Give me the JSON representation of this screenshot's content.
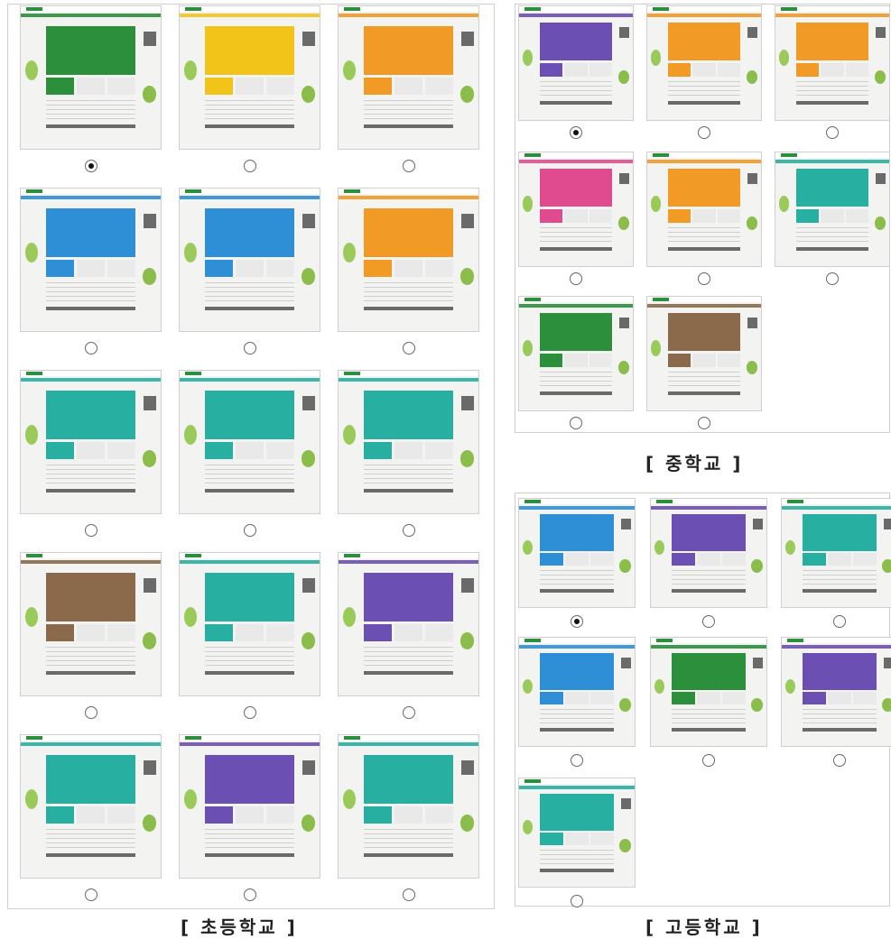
{
  "captions": {
    "elementary": "[ 초등학교 ]",
    "middle": "[ 중학교 ]",
    "high": "[ 고등학교 ]"
  },
  "palette": {
    "green": "#2b8f3b",
    "yellow": "#f2c41a",
    "orange": "#f19a26",
    "blue": "#2f8fd6",
    "teal": "#27b0a1",
    "purple": "#6b4fb3",
    "brown": "#8a6a4a",
    "pink": "#e04b8f",
    "gray": "#6a6a6a"
  },
  "elementary_designs": [
    {
      "theme": "green",
      "selected": true
    },
    {
      "theme": "yellow",
      "selected": false
    },
    {
      "theme": "orange",
      "selected": false
    },
    {
      "theme": "blue",
      "selected": false
    },
    {
      "theme": "blue",
      "selected": false
    },
    {
      "theme": "orange",
      "selected": false
    },
    {
      "theme": "teal",
      "selected": false
    },
    {
      "theme": "teal",
      "selected": false
    },
    {
      "theme": "teal",
      "selected": false
    },
    {
      "theme": "brown",
      "selected": false
    },
    {
      "theme": "teal",
      "selected": false
    },
    {
      "theme": "purple",
      "selected": false
    },
    {
      "theme": "teal",
      "selected": false
    },
    {
      "theme": "purple",
      "selected": false
    },
    {
      "theme": "teal",
      "selected": false
    }
  ],
  "middle_designs": [
    {
      "theme": "purple",
      "selected": true
    },
    {
      "theme": "orange",
      "selected": false
    },
    {
      "theme": "orange",
      "selected": false
    },
    {
      "theme": "pink",
      "selected": false
    },
    {
      "theme": "orange",
      "selected": false
    },
    {
      "theme": "teal",
      "selected": false
    },
    {
      "theme": "green",
      "selected": false
    },
    {
      "theme": "brown",
      "selected": false
    }
  ],
  "high_designs": [
    {
      "theme": "blue",
      "selected": true
    },
    {
      "theme": "purple",
      "selected": false
    },
    {
      "theme": "teal",
      "selected": false
    },
    {
      "theme": "blue",
      "selected": false
    },
    {
      "theme": "green",
      "selected": false
    },
    {
      "theme": "purple",
      "selected": false
    },
    {
      "theme": "teal",
      "selected": false
    }
  ]
}
